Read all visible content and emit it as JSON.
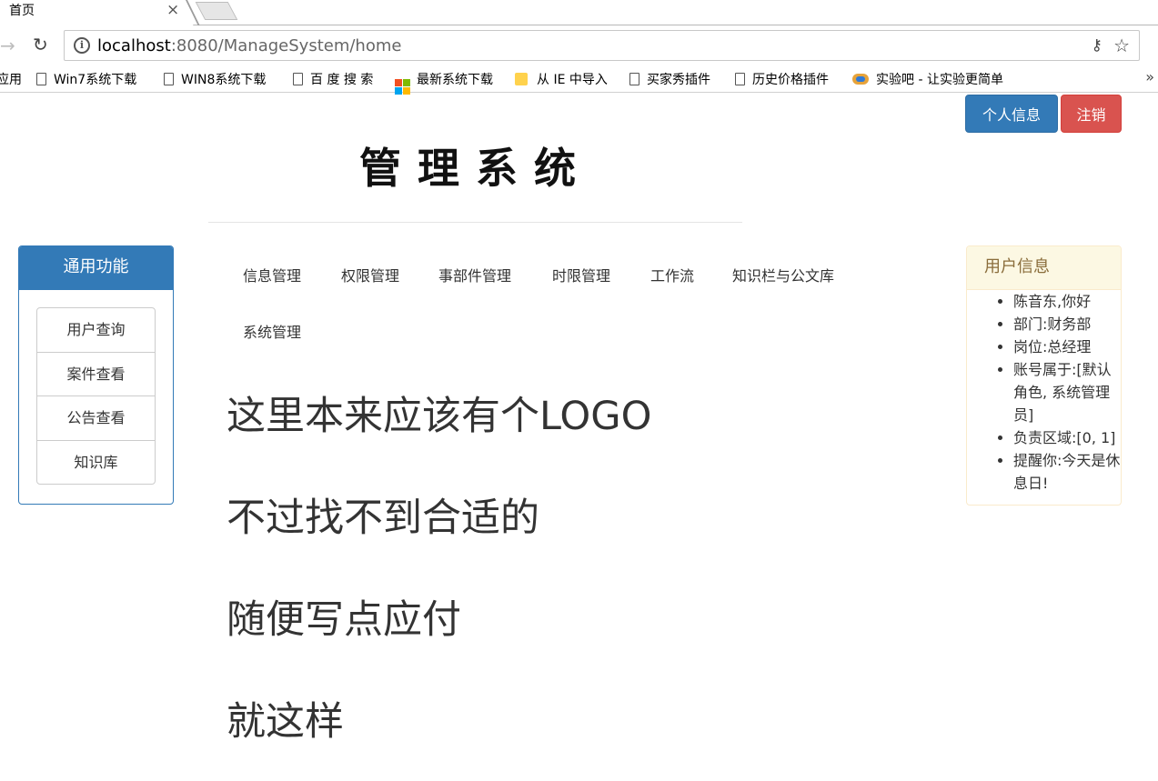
{
  "browser": {
    "tab_title": "首页",
    "tab_close": "×",
    "url_host": "localhost",
    "url_path": ":8080/ManageSystem/home",
    "bookmarks": [
      {
        "label": "应用",
        "icon": "apps-icon"
      },
      {
        "label": "Win7系统下载",
        "icon": "page-icon"
      },
      {
        "label": "WIN8系统下载",
        "icon": "page-icon"
      },
      {
        "label": "百 度 搜 索",
        "icon": "page-icon"
      },
      {
        "label": "最新系统下载",
        "icon": "windows-logo-icon"
      },
      {
        "label": "从 IE 中导入",
        "icon": "folder-icon"
      },
      {
        "label": "买家秀插件",
        "icon": "page-icon"
      },
      {
        "label": "历史价格插件",
        "icon": "page-icon"
      },
      {
        "label": "实验吧 - 让实验更简单",
        "icon": "lab-logo-icon"
      }
    ],
    "bookmarks_more": "»"
  },
  "header": {
    "profile_button": "个人信息",
    "logout_button": "注销",
    "title": "管理系统"
  },
  "colors": {
    "primary": "#337ab7",
    "danger": "#d9534f",
    "warning_bg": "#fcf8e3",
    "warning_text": "#8a6d3b"
  },
  "left_panel": {
    "heading": "通用功能",
    "items": [
      "用户查询",
      "案件查看",
      "公告查看",
      "知识库"
    ]
  },
  "main_nav": {
    "items": [
      "信息管理",
      "权限管理",
      "事部件管理",
      "时限管理",
      "工作流",
      "知识栏与公文库",
      "系统管理"
    ]
  },
  "body_text": {
    "lines": [
      "这里本来应该有个LOGO",
      "不过找不到合适的",
      "随便写点应付",
      "就这样"
    ]
  },
  "user_panel": {
    "heading": "用户信息",
    "items": [
      "陈音东,你好",
      "部门:财务部",
      "岗位:总经理",
      "账号属于:[默认角色, 系统管理员]",
      "负责区域:[0, 1]",
      "提醒你:今天是休息日!"
    ]
  }
}
